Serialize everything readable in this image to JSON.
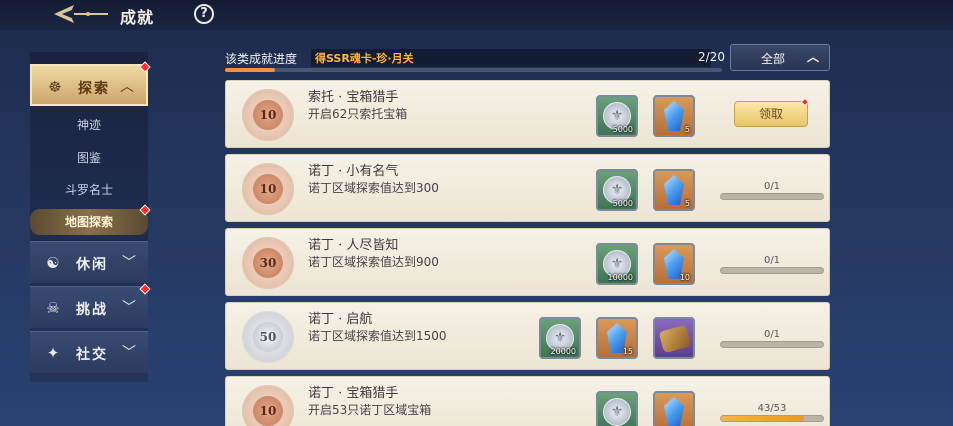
{
  "header": {
    "title": "成就",
    "help": "?"
  },
  "sidebar": {
    "categories": [
      {
        "label": "探索",
        "icon": "☸",
        "expanded": true,
        "reddot": true
      },
      {
        "label": "休闲",
        "icon": "☯",
        "expanded": false,
        "reddot": false
      },
      {
        "label": "挑战",
        "icon": "☠",
        "expanded": false,
        "reddot": true
      },
      {
        "label": "社交",
        "icon": "✦",
        "expanded": false,
        "reddot": false
      }
    ],
    "subitems": [
      {
        "label": "神迹",
        "active": false
      },
      {
        "label": "图鉴",
        "active": false
      },
      {
        "label": "斗罗名士",
        "active": false
      },
      {
        "label": "地图探索",
        "active": true,
        "reddot": true
      }
    ]
  },
  "progress": {
    "label": "该类成就进度",
    "banner": "得SSR魂卡-珍·月关",
    "count": "2/20",
    "fraction": 0.1
  },
  "filter": {
    "label": "全部"
  },
  "rows": [
    {
      "badge": "10",
      "badge_style": "bronze",
      "title": "索托 · 宝箱猎手",
      "desc": "开启62只索托宝箱",
      "rewards": [
        {
          "type": "coin",
          "qty": "5000"
        },
        {
          "type": "gem",
          "qty": "5"
        }
      ],
      "status": "claim",
      "claim_label": "领取"
    },
    {
      "badge": "10",
      "badge_style": "bronze",
      "title": "诺丁 · 小有名气",
      "desc": "诺丁区域探索值达到300",
      "rewards": [
        {
          "type": "coin",
          "qty": "5000"
        },
        {
          "type": "gem",
          "qty": "5"
        }
      ],
      "status": "progress",
      "progress_text": "0/1",
      "fraction": 0
    },
    {
      "badge": "30",
      "badge_style": "bronze",
      "title": "诺丁 · 人尽皆知",
      "desc": "诺丁区域探索值达到900",
      "rewards": [
        {
          "type": "coin",
          "qty": "10000"
        },
        {
          "type": "gem",
          "qty": "10"
        }
      ],
      "status": "progress",
      "progress_text": "0/1",
      "fraction": 0
    },
    {
      "badge": "50",
      "badge_style": "silver",
      "title": "诺丁 · 启航",
      "desc": "诺丁区域探索值达到1500",
      "rewards": [
        {
          "type": "coin",
          "qty": "20000"
        },
        {
          "type": "gem",
          "qty": "15"
        },
        {
          "type": "scroll",
          "qty": ""
        }
      ],
      "status": "progress",
      "progress_text": "0/1",
      "fraction": 0
    },
    {
      "badge": "10",
      "badge_style": "bronze",
      "title": "诺丁 · 宝箱猎手",
      "desc": "开启53只诺丁区域宝箱",
      "rewards": [
        {
          "type": "coin",
          "qty": ""
        },
        {
          "type": "gem",
          "qty": ""
        }
      ],
      "status": "progress",
      "progress_text": "43/53",
      "fraction": 0.81
    }
  ],
  "colors": {
    "accent": "#f08f46",
    "reddot": "#ff2a2a",
    "claim": "#e8c46a"
  }
}
